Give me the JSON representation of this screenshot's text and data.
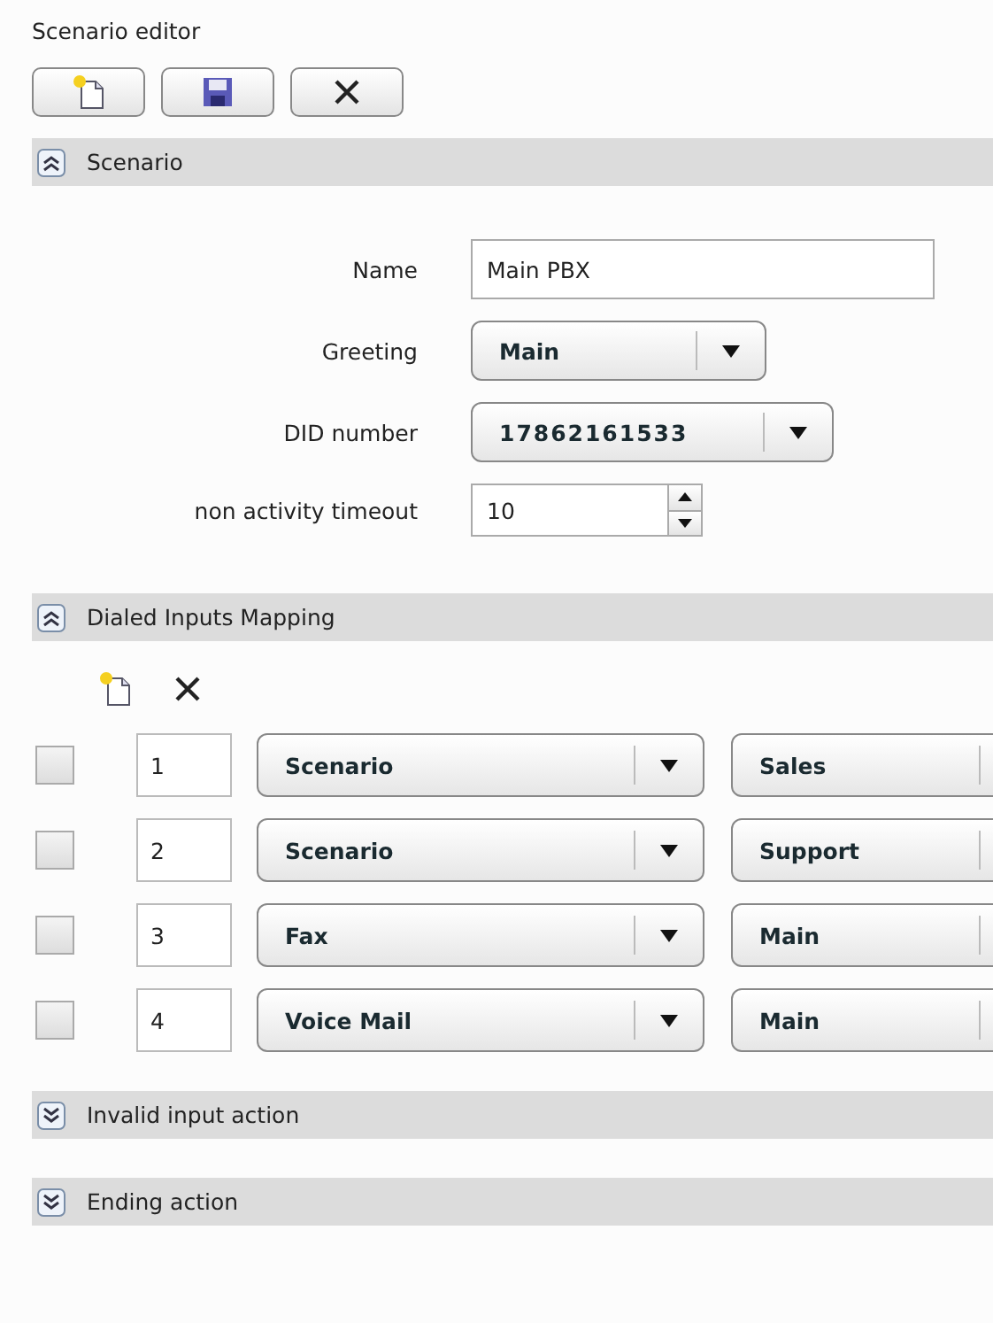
{
  "window": {
    "title": "Scenario editor"
  },
  "sections": [
    {
      "title": "Scenario",
      "expanded": true,
      "fields": [
        {
          "kind": "text",
          "label": "Name",
          "value": "Main PBX"
        },
        {
          "kind": "select",
          "label": "Greeting",
          "value": "Main"
        },
        {
          "kind": "select",
          "label": "DID number",
          "value": "17862161533"
        },
        {
          "kind": "spinner",
          "label": "non activity timeout",
          "value": "10"
        }
      ]
    },
    {
      "title": "Dialed Inputs Mapping",
      "expanded": true,
      "rows": [
        {
          "checked": false,
          "number": "1",
          "action": "Scenario",
          "target": "Sales"
        },
        {
          "checked": false,
          "number": "2",
          "action": "Scenario",
          "target": "Support"
        },
        {
          "checked": false,
          "number": "3",
          "action": "Fax",
          "target": "Main"
        },
        {
          "checked": false,
          "number": "4",
          "action": "Voice Mail",
          "target": "Main"
        }
      ]
    },
    {
      "title": "Invalid input action",
      "expanded": false
    },
    {
      "title": "Ending action",
      "expanded": false
    }
  ]
}
